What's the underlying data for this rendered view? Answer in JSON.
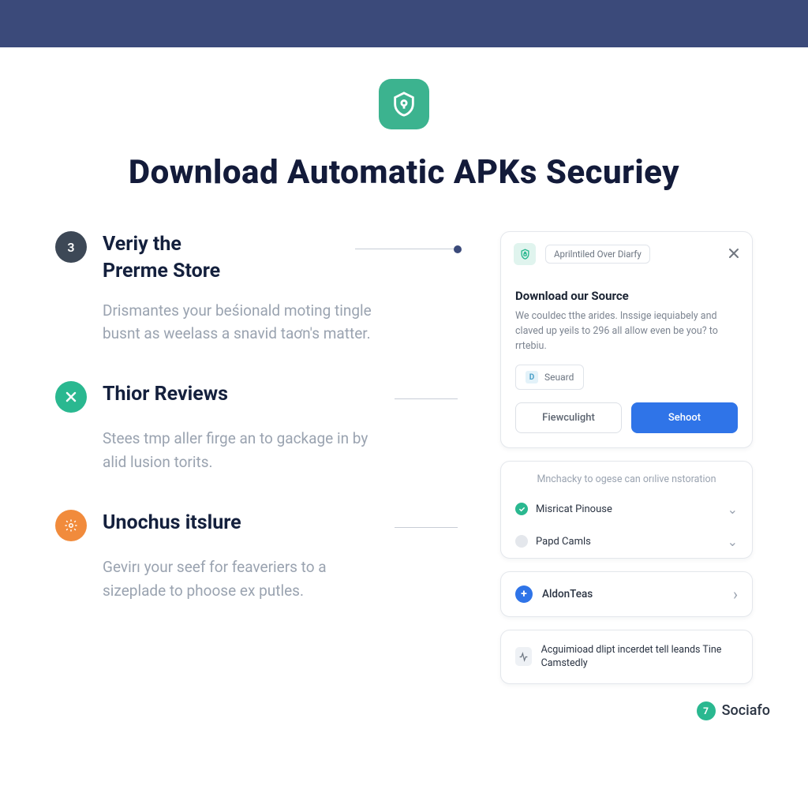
{
  "hero": {
    "title": "Download Automatic APKs Securiey"
  },
  "steps": [
    {
      "badge": "3",
      "badgeClass": "badge-dark",
      "iconType": "text",
      "title": "Veriy the\nPrerme Store",
      "body": "Drismantes your beśionald moting tingle busnt as weelass a snavid taơn's matter."
    },
    {
      "badge": "x",
      "badgeClass": "badge-green",
      "iconType": "x",
      "title": "Thior Reviews",
      "body": "Stees tmp aller firge an to gackage in by alid lusion torits."
    },
    {
      "badge": "s",
      "badgeClass": "badge-orange",
      "iconType": "settings",
      "title": "Unochus itslure",
      "body": "Gevirı your seef for feaveriers to a sizeplade to phoose ex putles."
    }
  ],
  "card1": {
    "tag": "Aprilntiled Over Diarfy",
    "title": "Download our Source",
    "text": "We couldec tthe arides. lnssige iequiabely and claved up yeils to 296 all allow even be you? to rrtebiu.",
    "chipLetter": "D",
    "chipText": "Seuard",
    "btnSecondary": "Fiewculight",
    "btnPrimary": "Sehoot"
  },
  "card2": {
    "info": "Mnchacky to ogese can orılive nstoration",
    "options": [
      {
        "label": "Misricat Pinouse",
        "status": "ok"
      },
      {
        "label": "Papd Camls",
        "status": "neutral"
      }
    ]
  },
  "card3": {
    "label": "AldonTeas"
  },
  "card4": {
    "text": "Acguimioad dlipt incerdet tell leands Tine Camstedly"
  },
  "footer": {
    "brand": "Sociafo",
    "badge": "7"
  }
}
